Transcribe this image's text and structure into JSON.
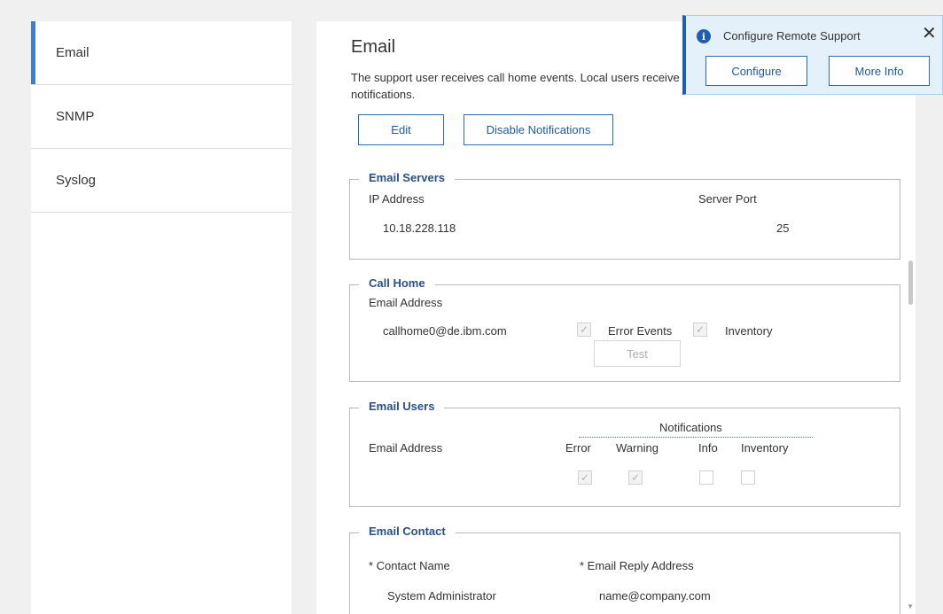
{
  "sidebar": {
    "items": [
      {
        "label": "Email"
      },
      {
        "label": "SNMP"
      },
      {
        "label": "Syslog"
      }
    ]
  },
  "main": {
    "title": "Email",
    "description_line1": "The support user receives call home events. Local users receive the selected",
    "description_line2": "notifications.",
    "edit_label": "Edit",
    "disable_label": "Disable Notifications"
  },
  "email_servers": {
    "legend": "Email Servers",
    "ip_header": "IP Address",
    "port_header": "Server Port",
    "ip_value": "10.18.228.118",
    "port_value": "25"
  },
  "call_home": {
    "legend": "Call Home",
    "email_header": "Email Address",
    "email_value": "callhome0@de.ibm.com",
    "error_events_label": "Error Events",
    "inventory_label": "Inventory",
    "test_label": "Test"
  },
  "email_users": {
    "legend": "Email Users",
    "email_header": "Email Address",
    "notifications_label": "Notifications",
    "error_label": "Error",
    "warning_label": "Warning",
    "info_label": "Info",
    "inventory_label": "Inventory"
  },
  "email_contact": {
    "legend": "Email Contact",
    "contact_name_label": "* Contact Name",
    "reply_address_label": "* Email Reply Address",
    "contact_name_value": "System Administrator",
    "reply_address_value": "name@company.com"
  },
  "notification": {
    "icon": "info-icon",
    "title": "Configure Remote Support",
    "configure_label": "Configure",
    "more_info_label": "More Info",
    "close_glyph": "✕"
  },
  "colors": {
    "accent": "#3f7cd8",
    "button_border": "#2d6bb5",
    "legend": "#2a4f8a",
    "notify_bg": "#e4f1fa"
  }
}
